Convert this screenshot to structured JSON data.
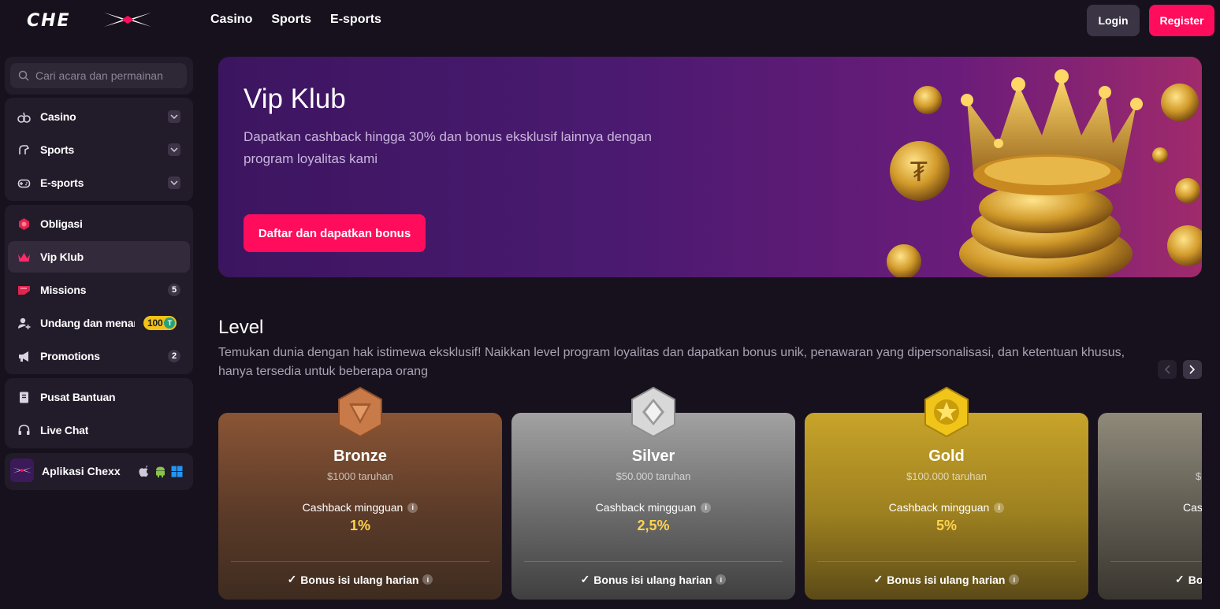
{
  "header": {
    "logo_text": "CHEXX",
    "nav": [
      "Casino",
      "Sports",
      "E-sports"
    ],
    "login_label": "Login",
    "register_label": "Register"
  },
  "sidebar": {
    "search_placeholder": "Cari acara dan permainan",
    "group1": [
      {
        "label": "Casino",
        "icon": "casino-icon"
      },
      {
        "label": "Sports",
        "icon": "sports-icon"
      },
      {
        "label": "E-sports",
        "icon": "gamepad-icon"
      }
    ],
    "group2": [
      {
        "label": "Obligasi",
        "icon": "bonds-icon"
      },
      {
        "label": "Vip Klub",
        "icon": "crown-icon"
      },
      {
        "label": "Missions",
        "icon": "missions-icon",
        "count": "5"
      },
      {
        "label": "Undang dan menang",
        "icon": "invite-icon",
        "badge": "100",
        "badge_coin": "T"
      },
      {
        "label": "Promotions",
        "icon": "megaphone-icon",
        "count": "2"
      }
    ],
    "group3": [
      {
        "label": "Pusat Bantuan",
        "icon": "help-book-icon"
      },
      {
        "label": "Live Chat",
        "icon": "headset-icon"
      }
    ],
    "app_label": "Aplikasi Chexx"
  },
  "hero": {
    "title": "Vip Klub",
    "subtitle": "Dapatkan cashback hingga 30% dan bonus eksklusif lainnya dengan program loyalitas kami",
    "cta": "Daftar dan dapatkan bonus"
  },
  "level": {
    "title": "Level",
    "description": "Temukan dunia dengan hak istimewa eksklusif! Naikkan level program loyalitas dan dapatkan bonus unik, penawaran yang dipersonalisasi, dan ketentuan khusus, hanya tersedia untuk beberapa orang",
    "cards": [
      {
        "name": "Bronze",
        "wager": "$1000 taruhan",
        "cashback_label": "Cashback mingguan",
        "cashback_value": "1%",
        "perk": "Bonus isi ulang harian"
      },
      {
        "name": "Silver",
        "wager": "$50.000 taruhan",
        "cashback_label": "Cashback mingguan",
        "cashback_value": "2,5%",
        "perk": "Bonus isi ulang harian"
      },
      {
        "name": "Gold",
        "wager": "$100.000 taruhan",
        "cashback_label": "Cashback mingguan",
        "cashback_value": "5%",
        "perk": "Bonus isi ulang harian"
      },
      {
        "name": "",
        "wager": "$",
        "cashback_label": "Cas",
        "cashback_value": "",
        "perk": "Bo"
      }
    ]
  },
  "colors": {
    "accent": "#ff0d5c",
    "background": "#17111d",
    "panel": "#221b2a",
    "cashback_value": "#ffd34d"
  }
}
